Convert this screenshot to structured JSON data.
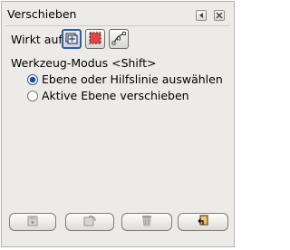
{
  "dock": {
    "title": "Verschieben",
    "menu_icon": "tab-menu-icon",
    "close_icon": "close-icon"
  },
  "affect": {
    "label": "Wirkt auf:",
    "options": [
      {
        "icon": "layer-icon",
        "selected": true
      },
      {
        "icon": "selection-icon",
        "selected": false
      },
      {
        "icon": "path-icon",
        "selected": false
      }
    ]
  },
  "tool_mode": {
    "label": "Werkzeug-Modus  <Shift>",
    "options": [
      {
        "label": "Ebene oder Hilfslinie auswählen",
        "checked": true
      },
      {
        "label": "Aktive Ebene verschieben",
        "checked": false
      }
    ]
  },
  "bottom_buttons": [
    {
      "icon": "save-icon",
      "enabled": false
    },
    {
      "icon": "restore-icon",
      "enabled": false
    },
    {
      "icon": "delete-icon",
      "enabled": false
    },
    {
      "icon": "reset-icon",
      "enabled": true
    }
  ]
}
